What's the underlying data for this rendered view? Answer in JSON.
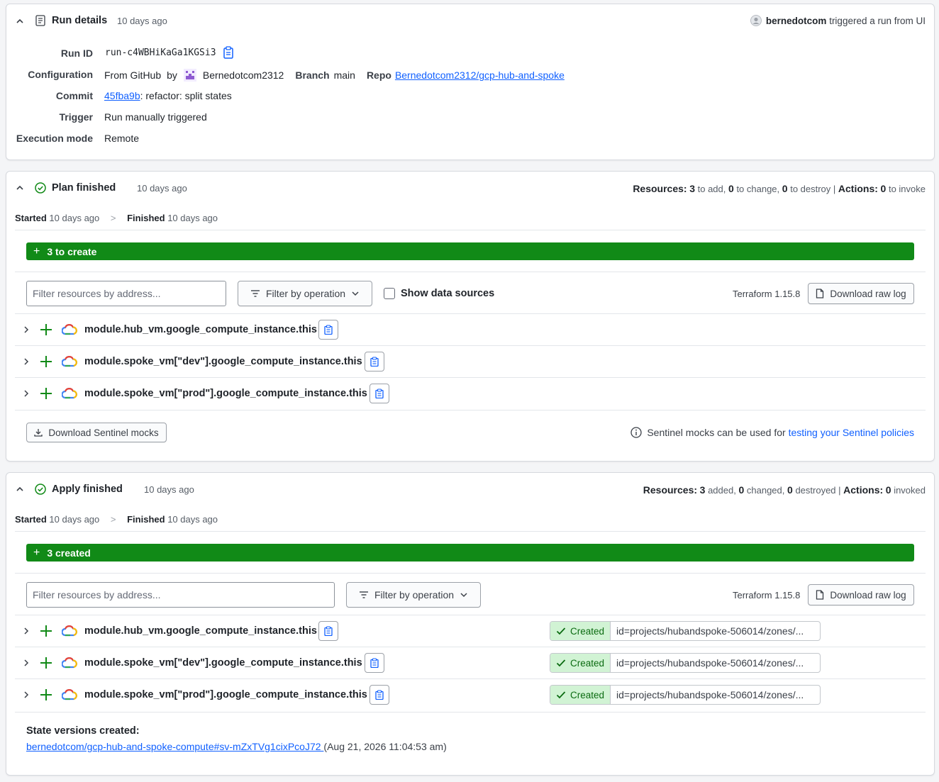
{
  "run_details": {
    "title": "Run details",
    "time": "10 days ago",
    "triggered_user": "bernedotcom",
    "triggered_text": " triggered a run from UI",
    "run_id_label": "Run ID",
    "run_id": "run-c4WBHiKaGa1KGSi3",
    "config_label": "Configuration",
    "config_from": "From GitHub",
    "config_by": "by",
    "config_user": "Bernedotcom2312",
    "branch_label": "Branch",
    "branch": "main",
    "repo_label": "Repo",
    "repo": "Bernedotcom2312/gcp-hub-and-spoke",
    "commit_label": "Commit",
    "commit_hash": "45fba9b",
    "commit_msg": ": refactor: split states",
    "trigger_label": "Trigger",
    "trigger": "Run manually triggered",
    "exec_label": "Execution mode",
    "exec": "Remote"
  },
  "plan": {
    "title": "Plan finished",
    "time": "10 days ago",
    "summary": {
      "resources_label": "Resources:",
      "add": "3",
      "add_text": "to add",
      "change": "0",
      "change_text": "to change",
      "destroy": "0",
      "destroy_text": "to destroy",
      "actions_label": "Actions:",
      "invoke": "0",
      "invoke_text": "to invoke"
    },
    "started_label": "Started",
    "started": "10 days ago",
    "finished_label": "Finished",
    "finished": "10 days ago",
    "bar": "3 to create",
    "filter_placeholder": "Filter resources by address...",
    "filter_op": "Filter by operation",
    "show_data_sources": "Show data sources",
    "terraform": "Terraform 1.15.8",
    "download_raw": "Download raw log",
    "resources": [
      "module.hub_vm.google_compute_instance.this",
      "module.spoke_vm[\"dev\"].google_compute_instance.this",
      "module.spoke_vm[\"prod\"].google_compute_instance.this"
    ],
    "download_mocks": "Download Sentinel mocks",
    "mocks_info": "Sentinel mocks can be used for ",
    "mocks_link": "testing your Sentinel policies"
  },
  "apply": {
    "title": "Apply finished",
    "time": "10 days ago",
    "summary": {
      "resources_label": "Resources:",
      "added": "3",
      "added_text": "added",
      "changed": "0",
      "changed_text": "changed",
      "destroyed": "0",
      "destroyed_text": "destroyed",
      "actions_label": "Actions:",
      "invoked": "0",
      "invoked_text": "invoked"
    },
    "started_label": "Started",
    "started": "10 days ago",
    "finished_label": "Finished",
    "finished": "10 days ago",
    "bar": "3 created",
    "filter_placeholder": "Filter resources by address...",
    "filter_op": "Filter by operation",
    "terraform": "Terraform 1.15.8",
    "download_raw": "Download raw log",
    "resources": [
      {
        "addr": "module.hub_vm.google_compute_instance.this",
        "status": "Created",
        "id": "id=projects/hubandspoke-506014/zones/..."
      },
      {
        "addr": "module.spoke_vm[\"dev\"].google_compute_instance.this",
        "status": "Created",
        "id": "id=projects/hubandspoke-506014/zones/..."
      },
      {
        "addr": "module.spoke_vm[\"prod\"].google_compute_instance.this",
        "status": "Created",
        "id": "id=projects/hubandspoke-506014/zones/..."
      }
    ],
    "state_label": "State versions created:",
    "state_link": "bernedotcom/gcp-hub-and-spoke-compute#sv-mZxTVg1cixPcoJ72 ",
    "state_date": "(Aug 21, 2026 11:04:53 am)"
  },
  "colors": {
    "accent": "#1060ff",
    "success": "#118a17",
    "created_bg": "#d1f3d4"
  }
}
